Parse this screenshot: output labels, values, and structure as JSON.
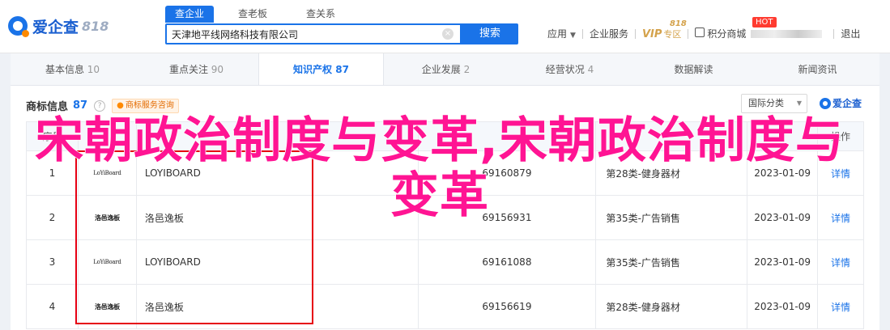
{
  "header": {
    "logo_text": "爱企查",
    "logo_818": "818",
    "search_tabs": [
      "查企业",
      "查老板",
      "查关系"
    ],
    "search_value": "天津地平线网络科技有限公司",
    "search_button": "搜索",
    "nav": {
      "app": "应用",
      "enterprise_service": "企业服务",
      "vip": "VIP",
      "vip_sub": "专区",
      "vip_818": "818",
      "points_mall": "积分商城",
      "hot": "HOT",
      "logout": "退出"
    }
  },
  "tabs": [
    {
      "label": "基本信息",
      "count": "10"
    },
    {
      "label": "重点关注",
      "count": "90"
    },
    {
      "label": "知识产权",
      "count": "87"
    },
    {
      "label": "企业发展",
      "count": "2"
    },
    {
      "label": "经营状况",
      "count": "4"
    },
    {
      "label": "数据解读",
      "count": ""
    },
    {
      "label": "新闻资讯",
      "count": ""
    }
  ],
  "section": {
    "title": "商标信息",
    "count": "87",
    "help": "?",
    "tag": "商标服务咨询",
    "filter": "国际分类",
    "brand": "爱企查"
  },
  "table": {
    "headers": [
      "序号",
      "",
      "",
      "",
      "",
      "",
      "操作"
    ],
    "rows": [
      {
        "no": "1",
        "logo": "LoYiBoard",
        "name": "LOYIBOARD",
        "reg": "69160879",
        "cls": "第28类-健身器材",
        "date": "2023-01-09",
        "op": "详情"
      },
      {
        "no": "2",
        "logo": "洛邑逸板",
        "name": "洛邑逸板",
        "reg": "69156931",
        "cls": "第35类-广告销售",
        "date": "2023-01-09",
        "op": "详情"
      },
      {
        "no": "3",
        "logo": "LoYiBoard",
        "name": "LOYIBOARD",
        "reg": "69161088",
        "cls": "第35类-广告销售",
        "date": "2023-01-09",
        "op": "详情"
      },
      {
        "no": "4",
        "logo": "洛邑逸板",
        "name": "洛邑逸板",
        "reg": "69156619",
        "cls": "第28类-健身器材",
        "date": "2023-01-09",
        "op": "详情"
      }
    ]
  },
  "overlay_text": "宋朝政治制度与变革,宋朝政治制度与变革",
  "colors": {
    "accent": "#1a73e8",
    "overlay": "#ff1493",
    "red_box": "#e60012"
  }
}
